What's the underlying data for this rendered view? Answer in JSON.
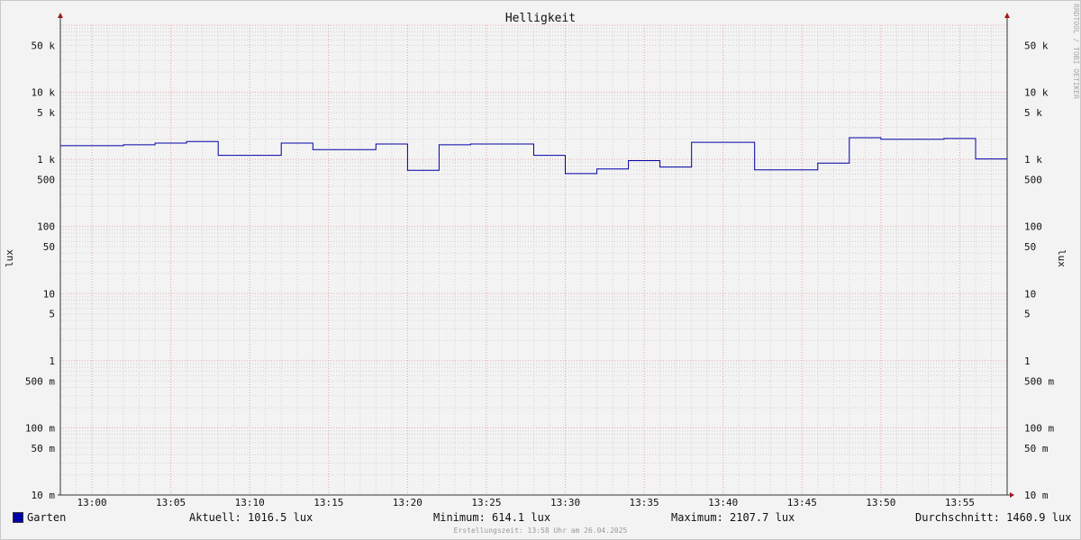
{
  "chart_data": {
    "type": "line",
    "title": "Helligkeit",
    "ylabel": "lux",
    "yscale": "log",
    "ylim": [
      0.01,
      100000
    ],
    "xlim": [
      "12:58",
      "13:58"
    ],
    "grid": true,
    "x_ticks": [
      "13:00",
      "13:05",
      "13:10",
      "13:15",
      "13:20",
      "13:25",
      "13:30",
      "13:35",
      "13:40",
      "13:45",
      "13:50",
      "13:55"
    ],
    "y_ticks": [
      {
        "value": 50000,
        "label": "50 k"
      },
      {
        "value": 10000,
        "label": "10 k"
      },
      {
        "value": 5000,
        "label": "5 k"
      },
      {
        "value": 1000,
        "label": "1 k"
      },
      {
        "value": 500,
        "label": "500"
      },
      {
        "value": 100,
        "label": "100"
      },
      {
        "value": 50,
        "label": "50"
      },
      {
        "value": 10,
        "label": "10"
      },
      {
        "value": 5,
        "label": "5"
      },
      {
        "value": 1,
        "label": "1"
      },
      {
        "value": 0.5,
        "label": "500 m"
      },
      {
        "value": 0.1,
        "label": "100 m"
      },
      {
        "value": 0.05,
        "label": "50 m"
      },
      {
        "value": 0.01,
        "label": "10 m"
      }
    ],
    "series": [
      {
        "name": "Garten",
        "color": "#0000a8",
        "steps": [
          {
            "t": "12:58",
            "v": 1600
          },
          {
            "t": "13:02",
            "v": 1650
          },
          {
            "t": "13:04",
            "v": 1750
          },
          {
            "t": "13:06",
            "v": 1850
          },
          {
            "t": "13:08",
            "v": 1150
          },
          {
            "t": "13:12",
            "v": 1750
          },
          {
            "t": "13:14",
            "v": 1400
          },
          {
            "t": "13:18",
            "v": 1700
          },
          {
            "t": "13:20",
            "v": 690
          },
          {
            "t": "13:22",
            "v": 1650
          },
          {
            "t": "13:24",
            "v": 1700
          },
          {
            "t": "13:28",
            "v": 1150
          },
          {
            "t": "13:30",
            "v": 614.1
          },
          {
            "t": "13:32",
            "v": 720
          },
          {
            "t": "13:34",
            "v": 960
          },
          {
            "t": "13:36",
            "v": 770
          },
          {
            "t": "13:38",
            "v": 1800
          },
          {
            "t": "13:42",
            "v": 700
          },
          {
            "t": "13:46",
            "v": 880
          },
          {
            "t": "13:48",
            "v": 2107.7
          },
          {
            "t": "13:50",
            "v": 2000
          },
          {
            "t": "13:54",
            "v": 2050
          },
          {
            "t": "13:56",
            "v": 1016.5
          },
          {
            "t": "13:58",
            "v": 1016.5
          }
        ]
      }
    ]
  },
  "legend": {
    "series_name": "Garten",
    "current": "Aktuell: 1016.5 lux",
    "minimum": "Minimum: 614.1 lux",
    "maximum": "Maximum: 2107.7 lux",
    "average": "Durchschnitt: 1460.9 lux"
  },
  "footer": "Erstellungszeit: 13:58 Uhr am 26.04.2025",
  "watermark": "RRDTOOL / TOBI OETIKER"
}
